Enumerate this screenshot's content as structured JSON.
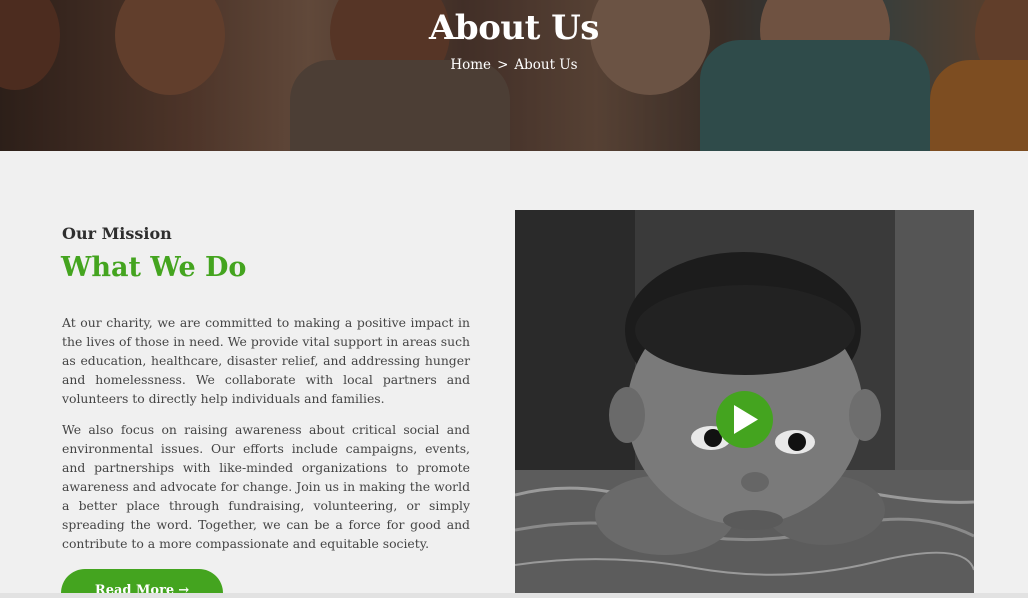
{
  "hero": {
    "title": "About Us",
    "breadcrumb": {
      "home": "Home",
      "separator": ">",
      "current": "About Us"
    }
  },
  "mission": {
    "subheading": "Our Mission",
    "heading": "What We Do",
    "paragraphs": [
      "At our charity, we are committed to making a positive impact in the lives of those in need. We provide vital support in areas such as education, healthcare, disaster relief, and addressing hunger and homelessness. We collaborate with local partners and volunteers to directly help individuals and families.",
      "We also focus on raising awareness about critical social and environmental issues. Our efforts include campaigns, events, and partnerships with like-minded organizations to promote awareness and advocate for change. Join us in making the world a better place through fundraising, volunteering, or simply spreading the word. Together, we can be a force for good and contribute to a more compassionate and equitable society."
    ],
    "read_more_label": "Read More",
    "read_more_arrow": "→"
  },
  "video": {
    "play_icon": "play-icon"
  },
  "colors": {
    "accent": "#44a41f",
    "background": "#f0f0f0",
    "text": "#444444"
  }
}
